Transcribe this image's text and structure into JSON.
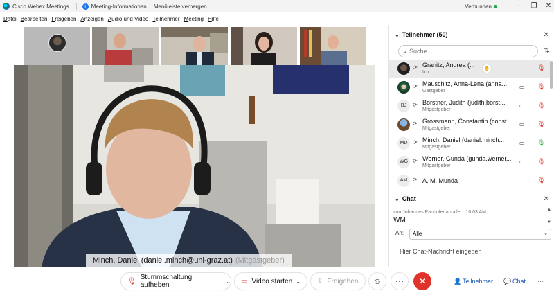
{
  "titlebar": {
    "app_title": "Cisco Webex Meetings",
    "info_label": "Meeting-Informationen",
    "hide_menu": "Menüleiste verbergen",
    "status": "Verbunden",
    "status_color": "#25a244"
  },
  "menu": [
    "Datei",
    "Bearbeiten",
    "Freigeben",
    "Anzeigen",
    "Audio und Video",
    "Teilnehmer",
    "Meeting",
    "Hilfe"
  ],
  "main_video": {
    "caption_name": "Minch, Daniel (daniel.minch@uni-graz.at)",
    "caption_role": "(Mitgastgeber)"
  },
  "controls": {
    "mute": "Stummschaltung aufheben",
    "video": "Video starten",
    "share": "Freigeben",
    "participants_tab": "Teilnehmer",
    "chat_tab": "Chat",
    "end_color": "#e0332b"
  },
  "participants": {
    "header": "Teilnehmer (50)",
    "search_placeholder": "Suche",
    "list": [
      {
        "name": "Granitz, Andrea (...",
        "role": "Ich",
        "avatar": "",
        "mic": "muted",
        "cam": false
      },
      {
        "name": "Mauschitz, Anna-Lena (anna...",
        "role": "Gastgeber",
        "avatar": "",
        "mic": "muted",
        "cam": true
      },
      {
        "name": "Borstner, Judith (judith.borst...",
        "role": "Mitgastgeber",
        "avatar": "BJ",
        "mic": "muted",
        "cam": true
      },
      {
        "name": "Grossmann, Constantin (const...",
        "role": "Mitgastgeber",
        "avatar": "",
        "mic": "muted",
        "cam": true
      },
      {
        "name": "Minch, Daniel (daniel.minch...",
        "role": "Mitgastgeber",
        "avatar": "MD",
        "mic": "active",
        "cam": true
      },
      {
        "name": "Werner, Gunda (gunda.werner...",
        "role": "Mitgastgeber",
        "avatar": "WG",
        "mic": "muted",
        "cam": true
      },
      {
        "name": "A. M. Munda",
        "role": "",
        "avatar": "AM",
        "mic": "muted",
        "cam": false
      }
    ]
  },
  "chat": {
    "header": "Chat",
    "message_meta": "von Johannes Panhofer an alle:",
    "message_time": "10:03 AM",
    "message_text": "WM",
    "to_label": "An:",
    "to_value": "Alle",
    "input_placeholder": "Hier Chat-Nachricht eingeben"
  }
}
